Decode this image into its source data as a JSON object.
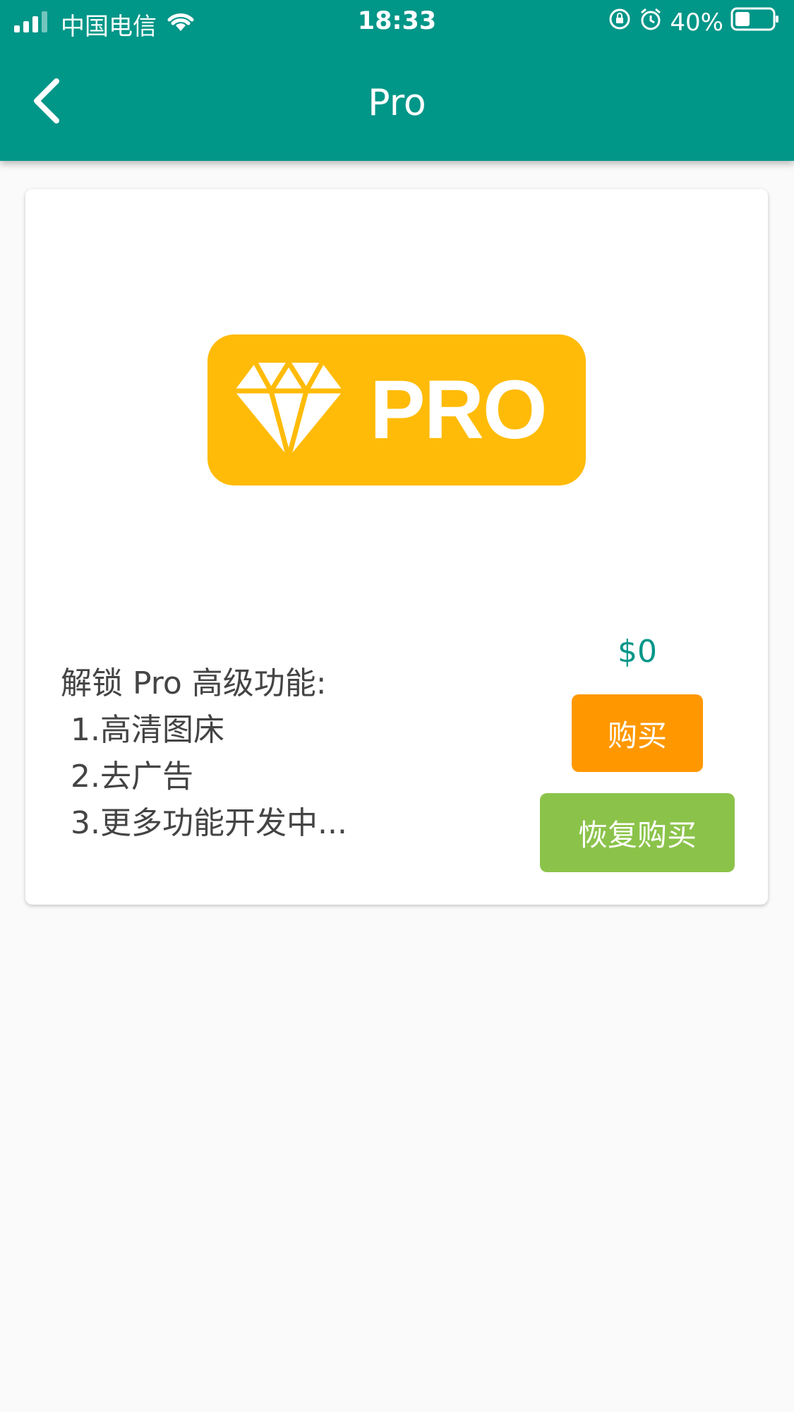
{
  "status_bar": {
    "carrier": "中国电信",
    "time": "18:33",
    "battery_percent": "40%",
    "battery_level": 0.4,
    "icons": [
      "signal-icon",
      "wifi-icon",
      "rotation-lock-icon",
      "alarm-icon",
      "battery-icon"
    ]
  },
  "header": {
    "title": "Pro",
    "back_icon": "back-chevron-icon"
  },
  "product": {
    "badge_label": "PRO",
    "badge_icon": "diamond-icon",
    "description": [
      "解锁 Pro 高级功能:",
      " 1.高清图床",
      " 2.去广告",
      " 3.更多功能开发中..."
    ],
    "price": "$0",
    "buy_label": "购买",
    "restore_label": "恢复购买"
  },
  "colors": {
    "primary": "#009688",
    "badge": "#ffbb07",
    "buy_button": "#ff9800",
    "restore_button": "#8bc34a",
    "background": "#fafafa"
  }
}
